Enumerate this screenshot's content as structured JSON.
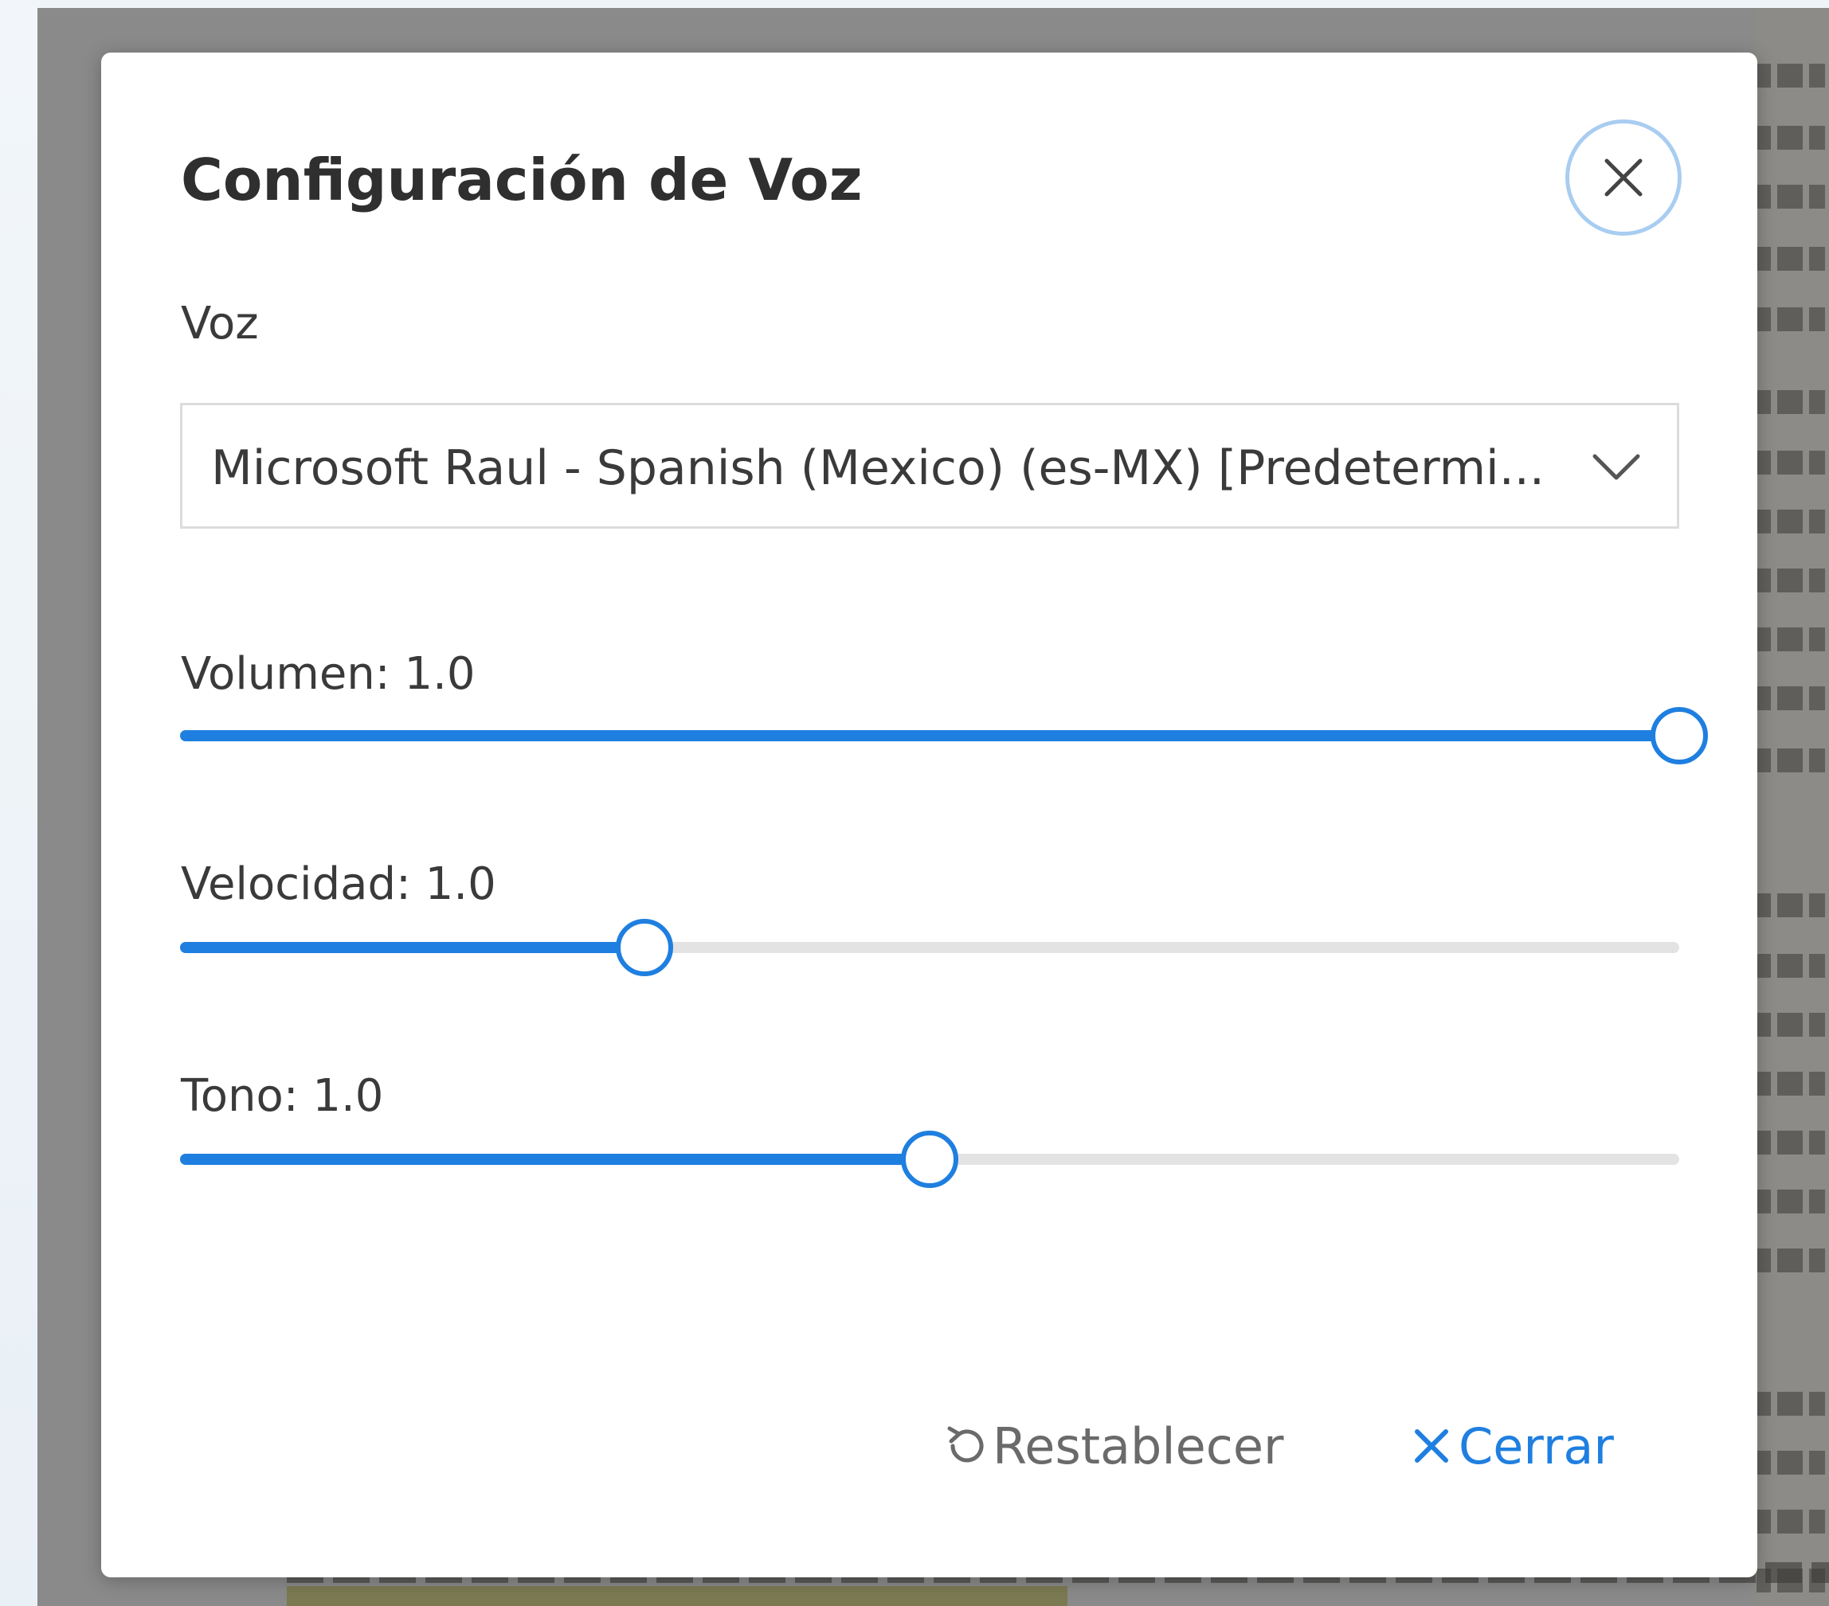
{
  "dialog": {
    "title": "Configuración de Voz",
    "voice_label": "Voz",
    "voice_selected": "Microsoft Raul - Spanish (Mexico) (es-MX) [Predetermi...",
    "sliders": [
      {
        "label": "Volumen: 1.0",
        "level_fraction": 1.0
      },
      {
        "label": "Velocidad: 1.0",
        "level_fraction": 0.31
      },
      {
        "label": "Tono: 1.0",
        "level_fraction": 0.5
      }
    ],
    "reset_label": "Restablecer",
    "close_label": "Cerrar"
  },
  "colors": {
    "accent": "#1f7fe0",
    "close_ring": "#a9cdf1",
    "track": "#e3e3e3",
    "overlay": "#8a8a8a"
  },
  "icons": {
    "close_top": "close-icon",
    "select_chevron": "chevron-down-icon",
    "reset": "reset-icon",
    "close_footer": "close-icon"
  }
}
